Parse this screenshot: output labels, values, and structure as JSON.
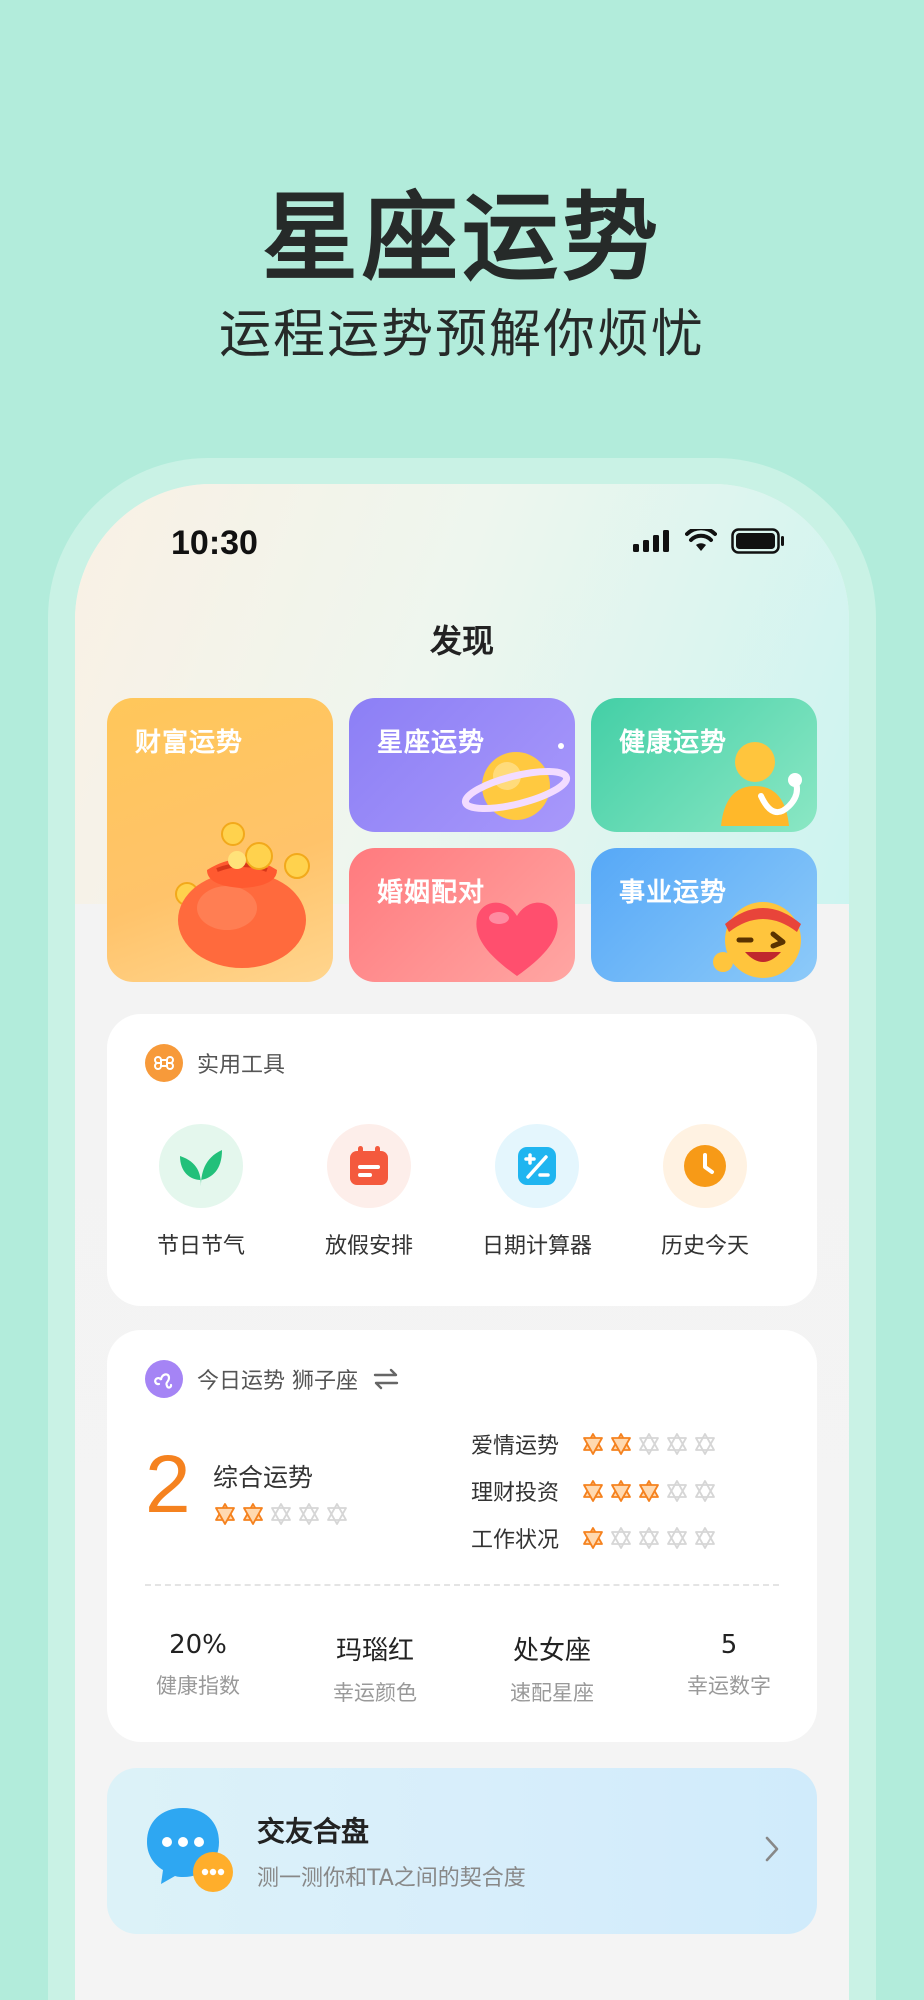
{
  "promo": {
    "headline": "星座运势",
    "subline": "运程运势预解你烦忧"
  },
  "status_bar": {
    "time": "10:30",
    "icons": [
      "signal-icon",
      "wifi-icon",
      "battery-icon"
    ]
  },
  "page": {
    "title": "发现"
  },
  "feature_cards": [
    {
      "label": "财富运势",
      "icon": "money-bag-icon"
    },
    {
      "label": "星座运势",
      "icon": "planet-icon"
    },
    {
      "label": "健康运势",
      "icon": "health-icon"
    },
    {
      "label": "婚姻配对",
      "icon": "heart-icon"
    },
    {
      "label": "事业运势",
      "icon": "career-emoji-icon"
    }
  ],
  "tools": {
    "title": "实用工具",
    "icon": "command-icon",
    "items": [
      {
        "label": "节日节气",
        "icon": "leaf-icon",
        "color": "#22c07a"
      },
      {
        "label": "放假安排",
        "icon": "calendar-icon",
        "color": "#f4593d"
      },
      {
        "label": "日期计算器",
        "icon": "calculator-icon",
        "color": "#1fb5f0"
      },
      {
        "label": "历史今天",
        "icon": "clock-icon",
        "color": "#f79a17"
      }
    ]
  },
  "fortune": {
    "title": "今日运势 狮子座",
    "icon": "leo-icon",
    "switch_icon": "swap-icon",
    "overall_score": "2",
    "overall_label": "综合运势",
    "overall_stars": 2,
    "ratings": [
      {
        "label": "爱情运势",
        "stars": 2
      },
      {
        "label": "理财投资",
        "stars": 3
      },
      {
        "label": "工作状况",
        "stars": 1
      }
    ],
    "stats": [
      {
        "value": "20%",
        "label": "健康指数"
      },
      {
        "value": "玛瑙红",
        "label": "幸运颜色"
      },
      {
        "value": "处女座",
        "label": "速配星座"
      },
      {
        "value": "5",
        "label": "幸运数字"
      }
    ]
  },
  "friend_match": {
    "title": "交友合盘",
    "subtitle": "测一测你和TA之间的契合度",
    "icon": "chat-bubble-icon"
  },
  "colors": {
    "background": "#b2ecdb",
    "star_active": "#f5821f",
    "accent_orange": "#f5821f"
  }
}
